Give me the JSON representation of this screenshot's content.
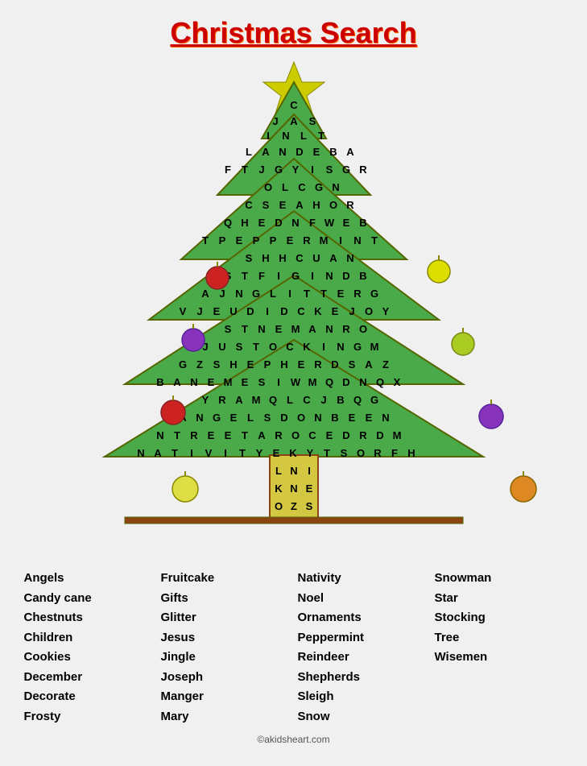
{
  "title": "Christmas Search",
  "copyright": "©akidsheart.com",
  "puzzle": {
    "rows": [
      [
        "C"
      ],
      [
        "J",
        "A",
        "S"
      ],
      [
        "I",
        "N",
        "L",
        "T"
      ],
      [
        "L",
        "A",
        "N",
        "D",
        "E",
        "B",
        "A"
      ],
      [
        "F",
        "T",
        "J",
        "G",
        "Y",
        "I",
        "S",
        "G",
        "R"
      ],
      [
        "O",
        "L",
        "C",
        "G",
        "N"
      ],
      [
        "C",
        "S",
        "E",
        "A",
        "H",
        "O",
        "R"
      ],
      [
        "Q",
        "H",
        "E",
        "D",
        "N",
        "F",
        "W",
        "E",
        "B"
      ],
      [
        "T",
        "P",
        "E",
        "P",
        "P",
        "E",
        "R",
        "M",
        "I",
        "N",
        "T"
      ],
      [
        "S",
        "H",
        "H",
        "C",
        "U",
        "A",
        "N"
      ],
      [
        "S",
        "T",
        "F",
        "I",
        "G",
        "I",
        "N",
        "D",
        "B"
      ],
      [
        "A",
        "J",
        "N",
        "G",
        "L",
        "I",
        "T",
        "T",
        "E",
        "R",
        "G"
      ],
      [
        "V",
        "J",
        "E",
        "U",
        "D",
        "I",
        "D",
        "C",
        "K",
        "E",
        "J",
        "O",
        "Y"
      ],
      [
        "S",
        "T",
        "N",
        "E",
        "M",
        "A",
        "N",
        "R",
        "O"
      ],
      [
        "J",
        "U",
        "S",
        "T",
        "O",
        "C",
        "K",
        "I",
        "N",
        "G",
        "M"
      ],
      [
        "G",
        "Z",
        "S",
        "H",
        "E",
        "P",
        "H",
        "E",
        "R",
        "D",
        "S",
        "A",
        "Z"
      ],
      [
        "B",
        "A",
        "N",
        "E",
        "M",
        "E",
        "S",
        "I",
        "W",
        "M",
        "Q",
        "D",
        "N",
        "Q",
        "X"
      ],
      [
        "Y",
        "R",
        "A",
        "M",
        "Q",
        "L",
        "C",
        "J",
        "B",
        "Q",
        "G"
      ],
      [
        "A",
        "N",
        "G",
        "E",
        "L",
        "S",
        "D",
        "O",
        "N",
        "B",
        "E",
        "E",
        "N"
      ],
      [
        "N",
        "T",
        "R",
        "E",
        "E",
        "T",
        "A",
        "R",
        "O",
        "C",
        "E",
        "D",
        "R",
        "D",
        "M"
      ],
      [
        "N",
        "A",
        "T",
        "I",
        "V",
        "I",
        "T",
        "Y",
        "E",
        "K",
        "Y",
        "T",
        "S",
        "O",
        "R",
        "F",
        "H"
      ],
      [
        "L",
        "N",
        "I"
      ],
      [
        "K",
        "N",
        "E"
      ],
      [
        "O",
        "Z",
        "S"
      ]
    ]
  },
  "words": {
    "col1": [
      "Angels",
      "Candy cane",
      "Chestnuts",
      "Children",
      "Cookies",
      "December",
      "Decorate",
      "Frosty"
    ],
    "col2": [
      "Fruitcake",
      "Gifts",
      "Glitter",
      "Jesus",
      "Jingle",
      "Joseph",
      "Manger",
      "Mary"
    ],
    "col3": [
      "Nativity",
      "Noel",
      "Ornaments",
      "Peppermint",
      "Reindeer",
      "Shepherds",
      "Sleigh",
      "Snow"
    ],
    "col4": [
      "Snowman",
      "Star",
      "Stocking",
      "Tree",
      "Wisemen"
    ]
  }
}
